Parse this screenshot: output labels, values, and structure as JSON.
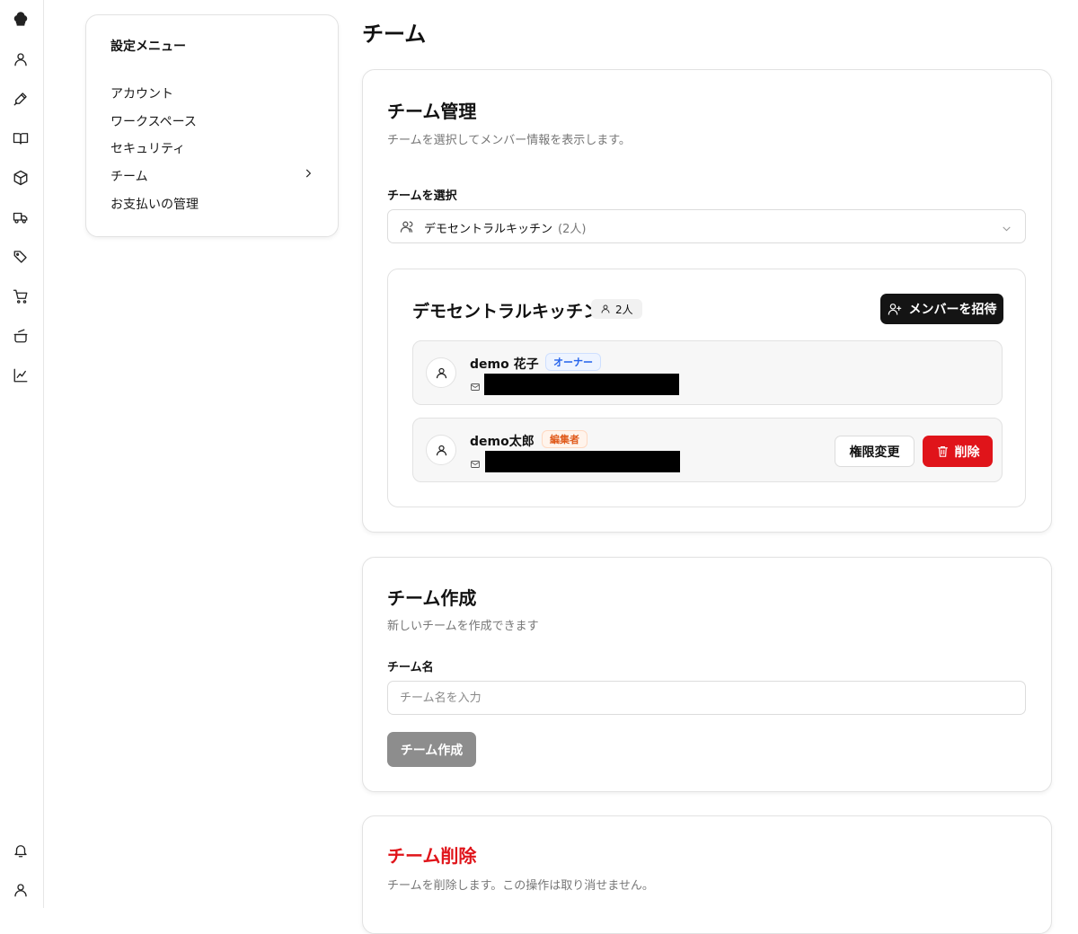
{
  "sidebar_icons": [
    "chef-hat-icon",
    "user-icon",
    "pen-icon",
    "book-icon",
    "box-icon",
    "truck-icon",
    "tags-icon",
    "cart-icon",
    "pot-icon",
    "chart-icon",
    "bell-icon",
    "user-icon"
  ],
  "settings_menu": {
    "title": "設定メニュー",
    "items": [
      {
        "label": "アカウント"
      },
      {
        "label": "ワークスペース"
      },
      {
        "label": "セキュリティ"
      },
      {
        "label": "チーム",
        "active": true
      },
      {
        "label": "お支払いの管理"
      }
    ]
  },
  "page": {
    "title": "チーム"
  },
  "team_management": {
    "title": "チーム管理",
    "description": "チームを選択してメンバー情報を表示します。",
    "select_label": "チームを選択",
    "selected_team": "デモセントラルキッチン",
    "selected_count": "(2人)",
    "team": {
      "name": "デモセントラルキッチン",
      "member_count": "2人",
      "invite_label": "メンバーを招待",
      "members": [
        {
          "name": "demo 花子",
          "role": "オーナー"
        },
        {
          "name": "demo太郎",
          "role": "編集者",
          "change_label": "権限変更",
          "delete_label": "削除"
        }
      ]
    }
  },
  "team_create": {
    "title": "チーム作成",
    "description": "新しいチームを作成できます",
    "name_label": "チーム名",
    "name_placeholder": "チーム名を入力",
    "name_value": "",
    "submit_label": "チーム作成"
  },
  "team_delete": {
    "title": "チーム削除",
    "description": "チームを削除します。この操作は取り消せません。"
  },
  "colors": {
    "primary": "#141414",
    "danger": "#e0141a",
    "owner_badge": "#2563eb",
    "editor_badge": "#e05a1b"
  }
}
